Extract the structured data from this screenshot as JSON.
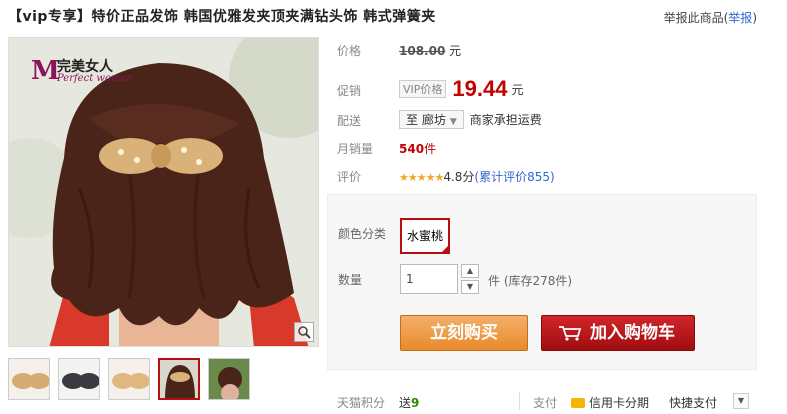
{
  "header": {
    "title": "【vip专享】特价正品发饰 韩国优雅发夹顶夹满钻头饰 韩式弹簧夹",
    "report_prefix": "举报此商品(",
    "report_link": "举报",
    "report_suffix": ")"
  },
  "gallery": {
    "logo_mark": "M",
    "logo_cn": "完美女人",
    "logo_en": "Perfect woman",
    "zoom_icon": "magnifier-icon",
    "thumb_count": 5,
    "active_thumb": 4
  },
  "info": {
    "price_label": "价格",
    "original_price": "108.00",
    "original_unit": "元",
    "promo_label": "促销",
    "vip_tag": "VIP价格",
    "promo_price": "19.44",
    "promo_unit": "元",
    "delivery_label": "配送",
    "delivery_to": "至 廊坊",
    "shipping_note": "商家承担运费",
    "sales_label": "月销量",
    "sales_value": "540",
    "sales_unit": "件",
    "rating_label": "评价",
    "rating_stars": "★★★★★",
    "rating_score": "4.8分",
    "rating_link": "(累计评价855)"
  },
  "options": {
    "color_label": "颜色分类",
    "color_value": "水蜜桃",
    "qty_label": "数量",
    "qty_value": "1",
    "qty_up": "▲",
    "qty_down": "▼",
    "stock_text": "件 (库存278件)",
    "buy_label": "立刻购买",
    "cart_label": "加入购物车"
  },
  "bottom": {
    "points_label": "天猫积分",
    "points_send": "送",
    "points_value": "9",
    "pay_label": "支付",
    "credit_label": "信用卡分期",
    "quick_pay": "快捷支付",
    "dd_arrow": "▼"
  },
  "colors": {
    "accent_red": "#c40000",
    "buy_orange": "#e9892b",
    "cart_red": "#a10d10"
  }
}
